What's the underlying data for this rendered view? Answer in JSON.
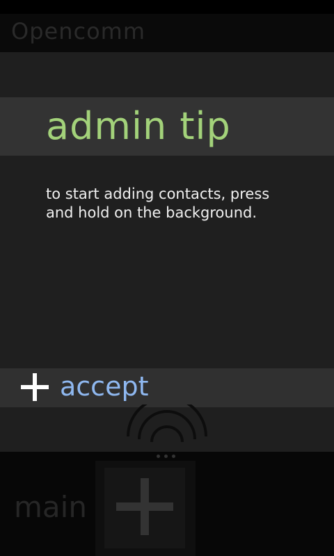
{
  "app": {
    "title": "Opencomm"
  },
  "dialog": {
    "title": "admin tip",
    "body": "to start adding contacts, press\nand hold on the background.",
    "accept_label": "accept"
  },
  "footer": {
    "section_label": "main"
  },
  "icons": {
    "accept": "plus-icon",
    "add_tile": "plus-icon",
    "signal": "wireless-signal-icon",
    "more": "ellipsis-icon"
  },
  "colors": {
    "title_accent": "#a3d27a",
    "action_accent": "#8fb8f0",
    "dialog_bg": "#1f1f1f",
    "band_bg": "#333333"
  }
}
